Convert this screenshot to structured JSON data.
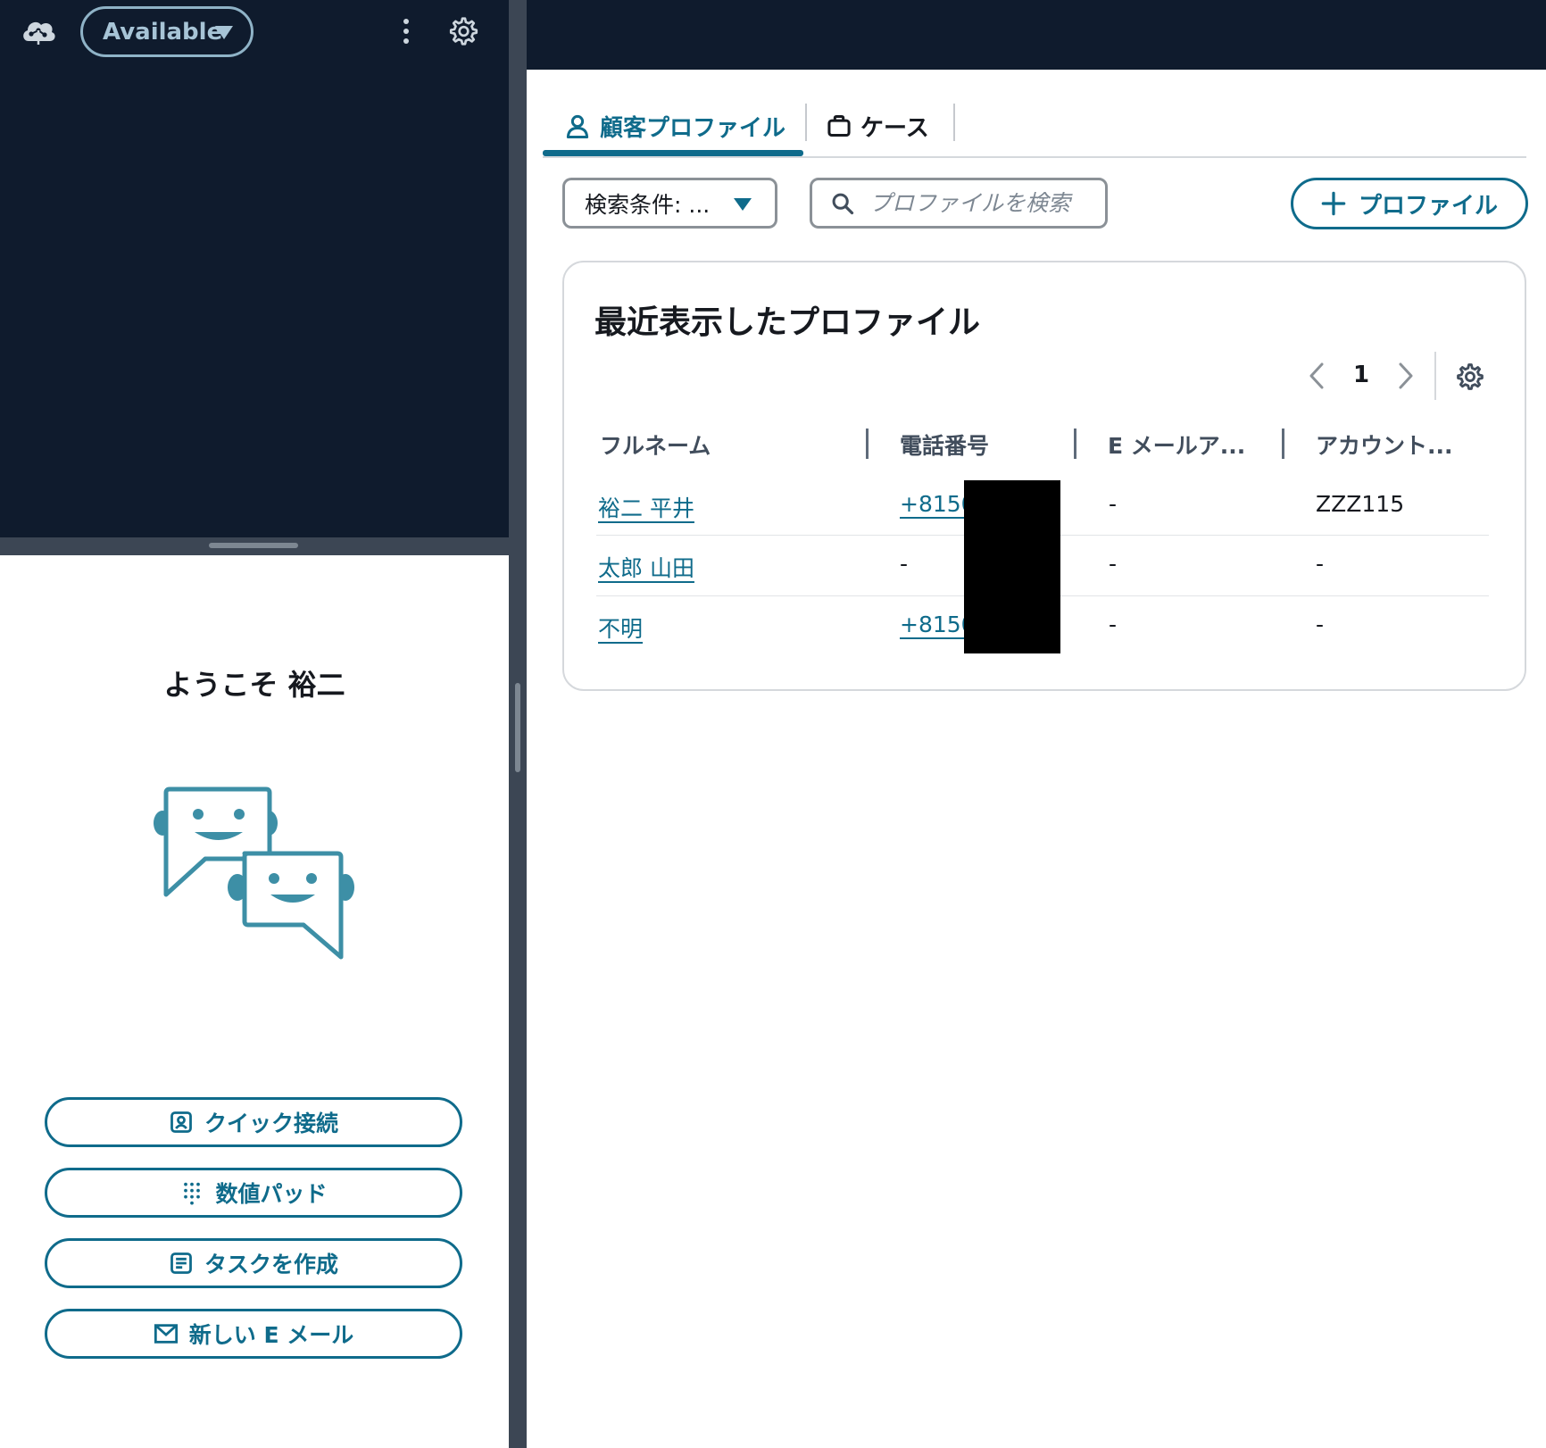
{
  "top_bar": {
    "status": "Available"
  },
  "left_panel": {
    "welcome": "ようこそ 裕二",
    "actions": [
      {
        "label": "クイック接続",
        "icon": "contact-card-icon"
      },
      {
        "label": "数値パッド",
        "icon": "keypad-icon"
      },
      {
        "label": "タスクを作成",
        "icon": "task-icon"
      },
      {
        "label": "新しい E メール",
        "icon": "mail-icon"
      }
    ]
  },
  "tabs": [
    {
      "label": "顧客プロファイル",
      "icon": "user-icon",
      "selected": true
    },
    {
      "label": "ケース",
      "icon": "briefcase-icon",
      "selected": false
    }
  ],
  "toolbar": {
    "filter_label": "検索条件: ...",
    "search_placeholder": "プロファイルを検索",
    "add_button": "プロファイル"
  },
  "recent_profiles": {
    "title": "最近表示したプロファイル",
    "page": "1",
    "columns": [
      "フルネーム",
      "電話番号",
      "E メールア...",
      "アカウント..."
    ],
    "rows": [
      {
        "name": "裕二 平井",
        "phone": "+8150",
        "email": "-",
        "account": "ZZZ115"
      },
      {
        "name": "太郎 山田",
        "phone": "-",
        "email": "-",
        "account": "-"
      },
      {
        "name": "不明",
        "phone": "+8150",
        "email": "-",
        "account": "-"
      }
    ]
  },
  "colors": {
    "accent": "#0f6b8b",
    "header_bg": "#0f1b2d",
    "divider": "#3c4654"
  }
}
